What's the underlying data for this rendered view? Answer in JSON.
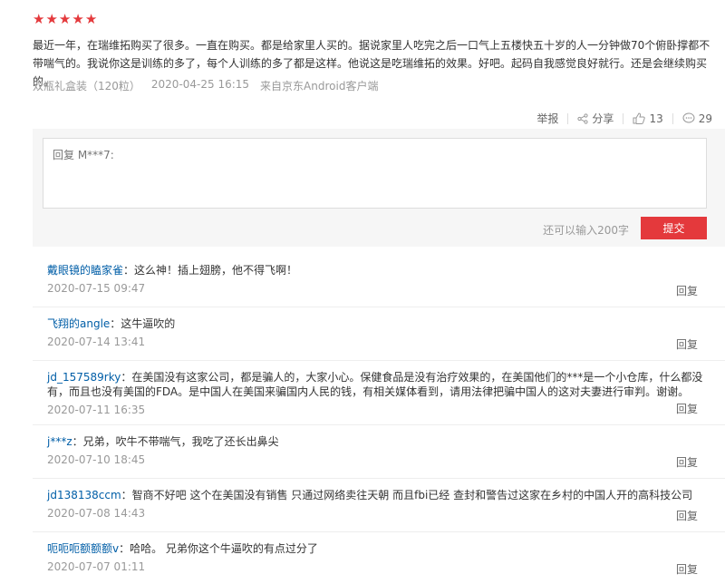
{
  "review": {
    "stars": [
      "★",
      "★",
      "★",
      "★",
      "★"
    ],
    "text": "最近一年，在瑞维拓购买了很多。一直在购买。都是给家里人买的。据说家里人吃完之后一口气上五楼快五十岁的人一分钟做70个俯卧撑都不带喘气的。我说你这是训练的多了，每个人训练的多了都是这样。他说这是吃瑞维拓的效果。好吧。起码自我感觉良好就行。还是会继续购买的。",
    "product": "双瓶礼盒装（120粒）",
    "datetime": "2020-04-25 16:15",
    "source": "来自京东Android客户端"
  },
  "actions": {
    "report": "举报",
    "share": "分享",
    "likes": "13",
    "comments": "29"
  },
  "reply_form": {
    "placeholder": "回复 M***7:",
    "counter": "还可以输入200字",
    "submit": "提交"
  },
  "comments": [
    {
      "user": "戴眼镜的瞌家雀",
      "text": "：这么神！插上翅膀，他不得飞啊！",
      "date": "2020-07-15 09:47",
      "reply": "回复"
    },
    {
      "user": "飞翔的angle",
      "text": "：这牛逼吹的",
      "date": "2020-07-14 13:41",
      "reply": "回复"
    },
    {
      "user": "jd_157589rky",
      "text": "：在美国没有这家公司，都是骗人的，大家小心。保健食品是没有治疗效果的，在美国他们的***是一个小仓库，什么都没有，而且也没有美国的FDA。是中国人在美国来骗国内人民的钱，有相关媒体看到，请用法律把骗中国人的这对夫妻进行审判。谢谢。",
      "date": "2020-07-11 16:35",
      "reply": "回复"
    },
    {
      "user": "j***z",
      "text": "：兄弟，吹牛不带喘气，我吃了还长出鼻尖",
      "date": "2020-07-10 18:45",
      "reply": "回复"
    },
    {
      "user": "jd138138ccm",
      "text": "：智商不好吧 这个在美国没有销售 只通过网络卖往天朝 而且fbi已经 查封和警告过这家在乡村的中国人开的高科技公司",
      "date": "2020-07-08 14:43",
      "reply": "回复"
    },
    {
      "user": "呃呃呃额额额v",
      "text": "：哈哈。 兄弟你这个牛逼吹的有点过分了",
      "date": "2020-07-07 01:11",
      "reply": "回复"
    }
  ]
}
